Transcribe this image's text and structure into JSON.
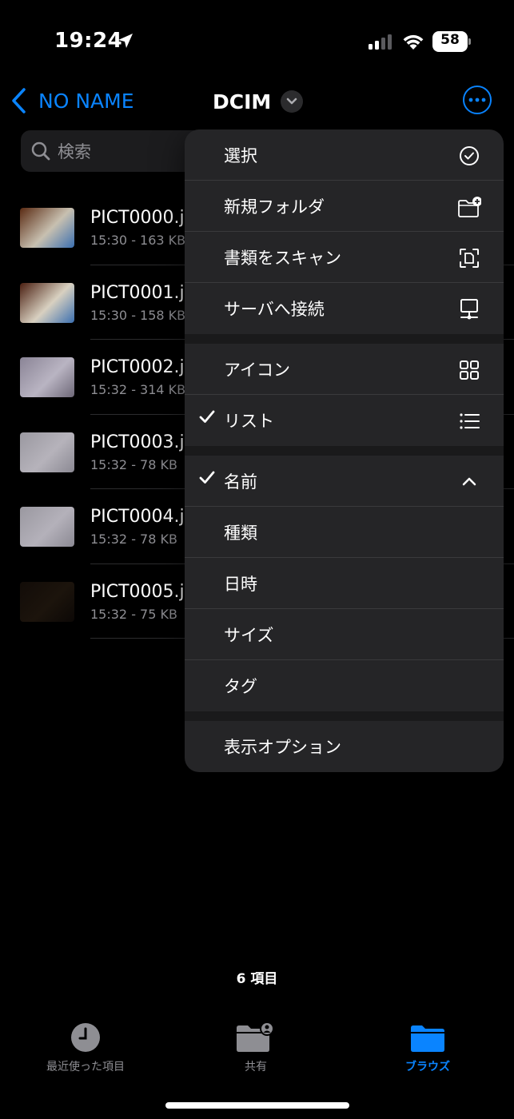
{
  "status_bar": {
    "time": "19:24",
    "battery": "58"
  },
  "nav": {
    "back_label": "NO NAME",
    "title": "DCIM"
  },
  "search": {
    "placeholder": "検索"
  },
  "files": [
    {
      "name": "PICT0000.j",
      "meta": "15:30 - 163 KB",
      "thumb_colors": [
        "#5a2a12",
        "#c8c0b0",
        "#3b6fb0"
      ]
    },
    {
      "name": "PICT0001.j",
      "meta": "15:30 - 158 KB",
      "thumb_colors": [
        "#4a1e10",
        "#d8d0c0",
        "#3b6fb0"
      ]
    },
    {
      "name": "PICT0002.j",
      "meta": "15:32 - 314 KB",
      "thumb_colors": [
        "#8a8496",
        "#b9b4c2",
        "#6e6878"
      ]
    },
    {
      "name": "PICT0003.j",
      "meta": "15:32 - 78 KB",
      "thumb_colors": [
        "#9a98a0",
        "#b6b3bb",
        "#8b8993"
      ]
    },
    {
      "name": "PICT0004.j",
      "meta": "15:32 - 78 KB",
      "thumb_colors": [
        "#9a98a0",
        "#b4b1ba",
        "#8b8993"
      ]
    },
    {
      "name": "PICT0005.j",
      "meta": "15:32 - 75 KB",
      "thumb_colors": [
        "#120c08",
        "#1c140c",
        "#0c0806"
      ]
    }
  ],
  "menu": {
    "items": [
      {
        "label": "選択",
        "icon": "checkmark-circle-icon",
        "checked": false
      },
      {
        "label": "新規フォルダ",
        "icon": "folder-plus-icon",
        "checked": false
      },
      {
        "label": "書類をスキャン",
        "icon": "doc-scanner-icon",
        "checked": false
      },
      {
        "label": "サーバへ接続",
        "icon": "server-display-icon",
        "checked": false
      },
      {
        "label": "アイコン",
        "icon": "grid-icon",
        "checked": false
      },
      {
        "label": "リスト",
        "icon": "list-icon",
        "checked": true
      },
      {
        "label": "名前",
        "icon": "chevron-up-icon",
        "checked": true
      },
      {
        "label": "種類",
        "icon": "",
        "checked": false
      },
      {
        "label": "日時",
        "icon": "",
        "checked": false
      },
      {
        "label": "サイズ",
        "icon": "",
        "checked": false
      },
      {
        "label": "タグ",
        "icon": "",
        "checked": false
      },
      {
        "label": "表示オプション",
        "icon": "",
        "checked": false
      }
    ]
  },
  "footer": {
    "item_count": "6 項目"
  },
  "tabs": [
    {
      "label": "最近使った項目",
      "icon": "clock-icon",
      "active": false
    },
    {
      "label": "共有",
      "icon": "shared-folder-icon",
      "active": false
    },
    {
      "label": "ブラウズ",
      "icon": "folder-icon",
      "active": true
    }
  ],
  "colors": {
    "accent": "#0a84ff",
    "background": "#000000",
    "menu_background": "#252527",
    "secondary_text": "#8e8e93"
  }
}
